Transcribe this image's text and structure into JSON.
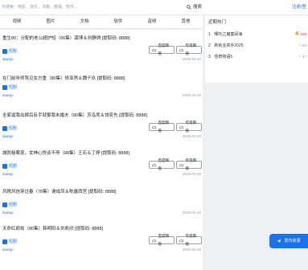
{
  "search": {
    "placeholder": "可搜索：电影、音乐、书籍、教程、软件...",
    "button_label": "搜索",
    "register_label": "注册/登"
  },
  "tabs": [
    {
      "label": "视频"
    },
    {
      "label": "图片"
    },
    {
      "label": "文档"
    },
    {
      "label": "软件"
    },
    {
      "label": "音频"
    },
    {
      "label": "其他"
    }
  ],
  "cards": [
    {
      "title": "重生80：分配的老公超护短（66集）龚博＆刘静琪 [提取码: 8888]",
      "tag": "短剧",
      "user": "duanju",
      "date": "2025-02-10",
      "baidu_label": "百度网盘",
      "quark_label": "夸克网盘"
    },
    {
      "title": "在门前听师驾见女方重（80集）修亚然＆魏千玖 [提取码: 8888]",
      "tag": "短剧",
      "user": "duanju",
      "date": "2025-02-10",
      "baidu_label": "百度网盘",
      "quark_label": "夸克网盘"
    },
    {
      "title": "全家逼我出嫁后反手就娶我未婚夫（80集）苏泓竞＆饶奕先 [提取码: 8888]",
      "tag": "短剧",
      "user": "duanju",
      "date": "2025-02-10",
      "baidu_label": "百度网盘",
      "quark_label": "夸克网盘"
    },
    {
      "title": "城防秘案现，女神心悦谈不停（88集）王石＆丁婷 [提取码: 8888]",
      "tag": "短剧",
      "user": "duanju",
      "date": "2025-02-10",
      "baidu_label": "百度网盘",
      "quark_label": "夸克网盘"
    },
    {
      "title": "风携风信穿过春（78集）谢成凤＆陈露西宫 [提取码: 8888]",
      "tag": "短剧",
      "user": "duanju",
      "date": "2025-02-10",
      "baidu_label": "百度网盘",
      "quark_label": "夸克网盘"
    },
    {
      "title": "天命红颜劫（80集）韩明阳＆刘凯欣 [提取码: 8888]",
      "tag": "短剧",
      "user": "duanju",
      "date": "2025-02-10",
      "baidu_label": "百度网盘",
      "quark_label": "夸克网盘"
    }
  ],
  "sidebar": {
    "title": "近期热门",
    "items": [
      {
        "rank": "1",
        "label": "哪吒之魔童闹海",
        "count": "199"
      },
      {
        "rank": "2",
        "label": "新就业高手2025",
        "count": "53"
      },
      {
        "rank": "3",
        "label": "怪奇物语5",
        "count": "47"
      }
    ]
  },
  "fab_label": "发布资源",
  "colors": {
    "accent": "#1a73e8",
    "hot": "#e53935"
  }
}
